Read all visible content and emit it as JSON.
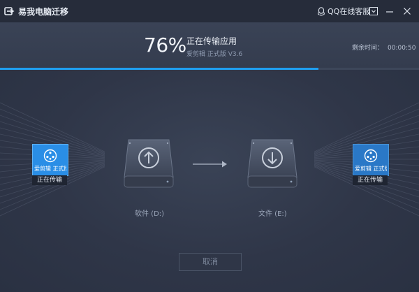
{
  "app": {
    "title": "易我电脑迁移"
  },
  "titlebar": {
    "support_label": "QQ在线客服"
  },
  "progress": {
    "percent_text": "76%",
    "value": 0.76,
    "status": "正在传输应用",
    "current_item": "爱剪辑 正式版 V3.6",
    "remaining_label": "剩余时间：",
    "remaining_value": "00:00:50"
  },
  "source": {
    "app_name": "爱剪辑 正式版 V3.6",
    "state": "正在传输",
    "drive_label": "软件 (D:)"
  },
  "target": {
    "app_name": "爱剪辑 正式版 V3.6",
    "state": "正在传输",
    "drive_label": "文件 (E:)"
  },
  "actions": {
    "cancel_label": "取消"
  },
  "colors": {
    "accent": "#1f9ff0",
    "app_tile": "#2a8ee6",
    "background": "#2c3344"
  }
}
